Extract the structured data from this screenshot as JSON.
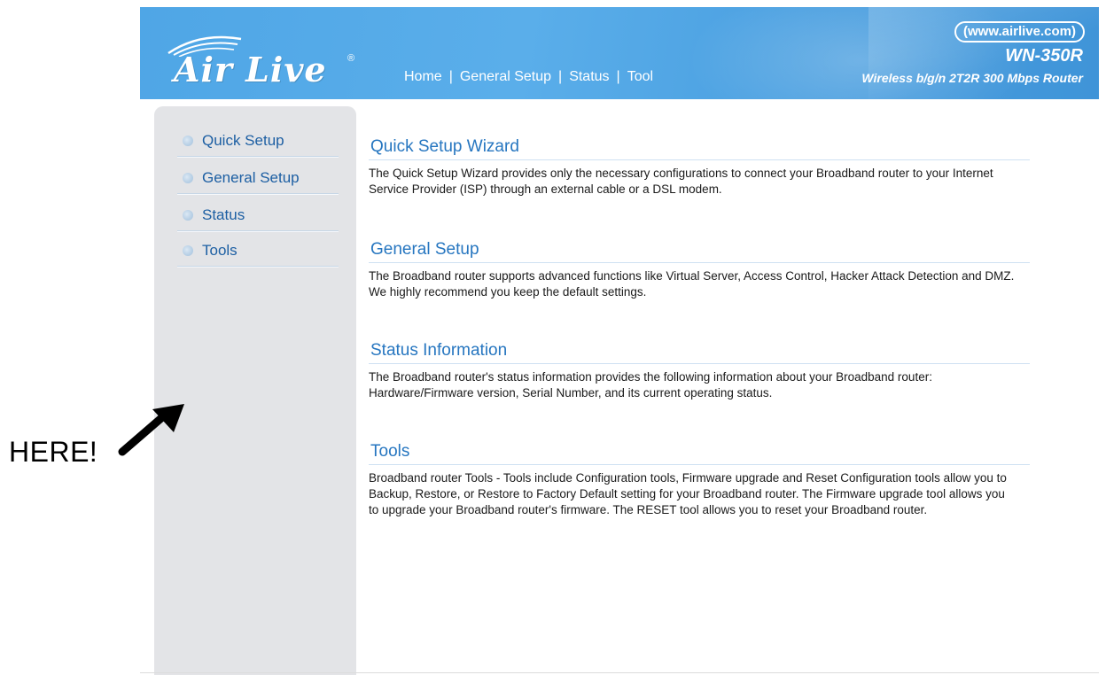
{
  "header": {
    "logo_text": "Air Live",
    "logo_mark": "®",
    "site_url": "(www.airlive.com)",
    "model": "WN-350R",
    "tagline": "Wireless b/g/n 2T2R 300 Mbps Router",
    "nav": [
      {
        "label": "Home"
      },
      {
        "label": "General Setup"
      },
      {
        "label": "Status"
      },
      {
        "label": "Tool"
      }
    ],
    "nav_separator": "|"
  },
  "sidebar": {
    "items": [
      {
        "label": "Quick Setup",
        "icon": "bullet-icon"
      },
      {
        "label": "General Setup",
        "icon": "bullet-icon"
      },
      {
        "label": "Status",
        "icon": "bullet-icon"
      },
      {
        "label": "Tools",
        "icon": "bullet-icon"
      }
    ]
  },
  "main": {
    "sections": [
      {
        "title": "Quick Setup Wizard",
        "body": "The Quick Setup Wizard provides only the necessary configurations to connect your Broadband router to your Internet Service Provider (ISP) through an external cable or a DSL modem."
      },
      {
        "title": "General Setup",
        "body": "The Broadband router supports advanced functions like Virtual Server, Access Control, Hacker Attack Detection and DMZ. We highly recommend you keep the default settings."
      },
      {
        "title": "Status Information",
        "body": "The Broadband router's status information provides the following information about your Broadband router: Hardware/Firmware version, Serial Number, and its current operating status."
      },
      {
        "title": "Tools",
        "body": "Broadband router Tools - Tools include Configuration tools, Firmware upgrade and Reset Configuration tools allow you to Backup, Restore, or Restore to Factory Default setting for your Broadband router. The Firmware upgrade tool allows you to upgrade your Broadband router's firmware. The RESET tool allows you to reset your Broadband router."
      }
    ]
  },
  "annotation": {
    "text": "HERE!",
    "icon": "arrow-icon"
  },
  "colors": {
    "banner": "#4fa6e6",
    "sidebar_bg": "#e3e4e7",
    "sidebar_link": "#1d5fa3",
    "section_title": "#2676c0"
  }
}
